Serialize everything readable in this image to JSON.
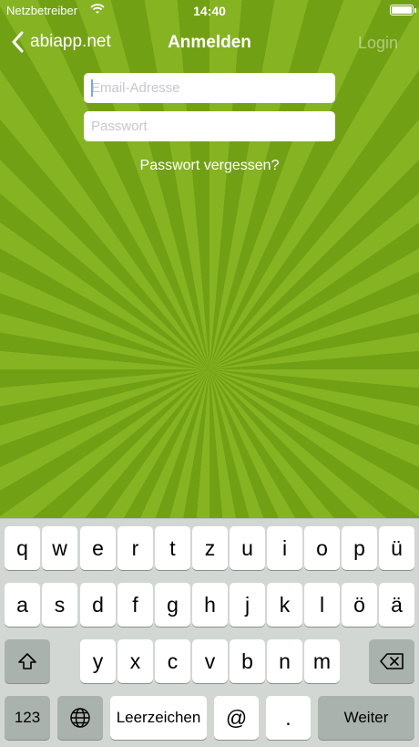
{
  "status_bar": {
    "carrier": "Netzbetreiber",
    "time": "14:40"
  },
  "nav": {
    "back_label": "abiapp.net",
    "title": "Anmelden",
    "login_label": "Login"
  },
  "form": {
    "email_placeholder": "Email-Adresse",
    "password_placeholder": "Passwort",
    "forgot_label": "Passwort vergessen?"
  },
  "keyboard": {
    "row1": [
      "q",
      "w",
      "e",
      "r",
      "t",
      "z",
      "u",
      "i",
      "o",
      "p",
      "ü"
    ],
    "row2": [
      "a",
      "s",
      "d",
      "f",
      "g",
      "h",
      "j",
      "k",
      "l",
      "ö",
      "ä"
    ],
    "row3": [
      "y",
      "x",
      "c",
      "v",
      "b",
      "n",
      "m"
    ],
    "numbers_label": "123",
    "space_label": "Leerzeichen",
    "at_label": "@",
    "dot_label": ".",
    "return_label": "Weiter"
  }
}
